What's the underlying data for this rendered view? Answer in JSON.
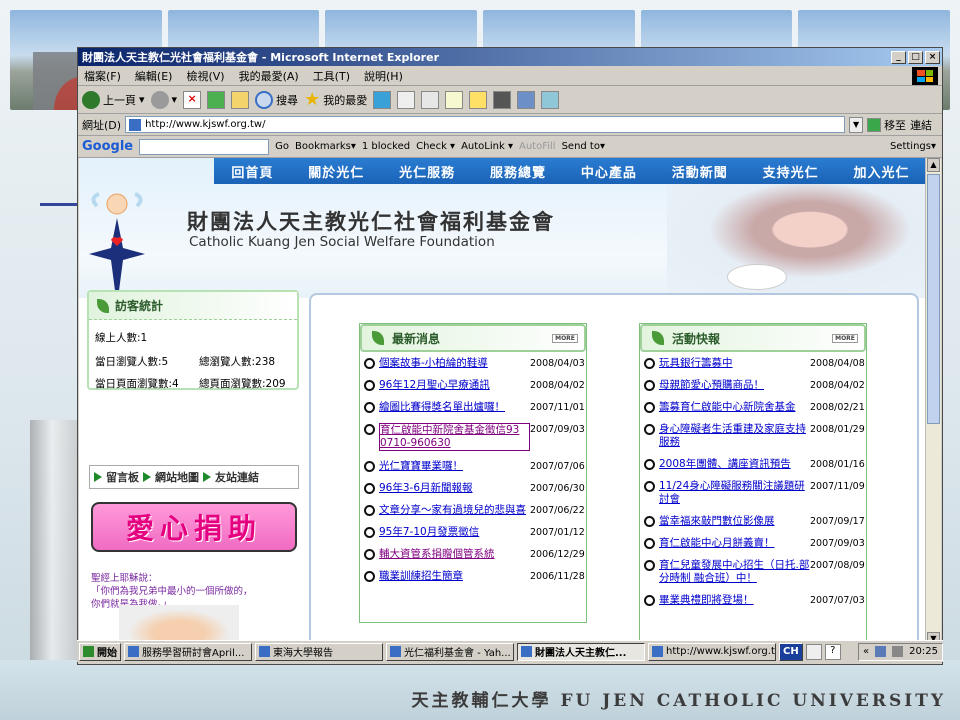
{
  "slide": {
    "university": "天主教輔仁大學 FU JEN CATHOLIC UNIVERSITY"
  },
  "window": {
    "title": "財團法人天主教仁光社會福利基金會 - Microsoft Internet Explorer",
    "controls": [
      "_",
      "□",
      "×"
    ]
  },
  "menu": [
    "檔案(F)",
    "編輯(E)",
    "檢視(V)",
    "我的最愛(A)",
    "工具(T)",
    "說明(H)"
  ],
  "toolbar": {
    "back": "上一頁",
    "search": "搜尋",
    "favorites": "我的最愛"
  },
  "address": {
    "label": "網址(D)",
    "url": "http://www.kjswf.org.tw/",
    "go": "移至",
    "links": "連結"
  },
  "google": {
    "logo": "Google",
    "go": "Go",
    "bookmarks": "Bookmarks▾",
    "blocked": "1 blocked",
    "check": "Check ▾",
    "autolink": "AutoLink ▾",
    "autofill": "AutoFill",
    "sendto": "Send to▾",
    "settings": "Settings▾"
  },
  "site": {
    "nav": [
      "回首頁",
      "關於光仁",
      "光仁服務",
      "服務總覽",
      "中心產品",
      "活動新聞",
      "支持光仁",
      "加入光仁"
    ],
    "org_name": "財團法人天主教光仁社會福利基金會",
    "org_english": "Catholic Kuang Jen Social Welfare Foundation",
    "stats": {
      "title": "訪客統計",
      "online": "線上人數:1",
      "today": "當日瀏覽人數:5",
      "total": "總瀏覽人數:238",
      "today_pages": "當日頁面瀏覽數:4",
      "total_pages": "總頁面瀏覽數:209"
    },
    "links": [
      "留言板",
      "網站地圖",
      "友站連結"
    ],
    "donate": "愛心捐助",
    "quote_line1": "聖經上耶穌說：",
    "quote_line2": "「你們為我兄弟中最小的一個所做的，",
    "quote_line3": "你們就是為我做。」",
    "more": "MORE",
    "news": {
      "title": "最新消息",
      "items": [
        {
          "text": "個案故事-小柏綸的鞋導",
          "date": "2008/04/03"
        },
        {
          "text": "96年12月聖心早療通訊",
          "date": "2008/04/02"
        },
        {
          "text": "繪圖比賽得獎名單出爐囉！",
          "date": "2007/11/01"
        },
        {
          "text": "育仁啟能中新院舍基金徵信93 0710-960630",
          "date": "2007/09/03"
        },
        {
          "text": "光仁寶寶畢業囉！",
          "date": "2007/07/06"
        },
        {
          "text": "96年3-6月新聞報報",
          "date": "2007/06/30"
        },
        {
          "text": "文章分享～家有過境兒的悲與喜",
          "date": "2007/06/22"
        },
        {
          "text": "95年7-10月發票徵信",
          "date": "2007/01/12"
        },
        {
          "text": "輔大資管系捐贈個管系統",
          "date": "2006/12/29"
        },
        {
          "text": "職業訓練招生簡章",
          "date": "2006/11/28"
        }
      ]
    },
    "events": {
      "title": "活動快報",
      "items": [
        {
          "text": "玩具銀行籌募中",
          "date": "2008/04/08"
        },
        {
          "text": "母親節愛心預購商品！",
          "date": "2008/04/02"
        },
        {
          "text": "籌募育仁啟能中心新院舍基金",
          "date": "2008/02/21"
        },
        {
          "text": "身心障礙者生活重建及家庭支持服務",
          "date": "2008/01/29"
        },
        {
          "text": "2008年團體、講座資訊預告",
          "date": "2008/01/16"
        },
        {
          "text": "11/24身心障礙服務關注議題研討會",
          "date": "2007/11/09"
        },
        {
          "text": "當幸福來敲門數位影像展",
          "date": "2007/09/17"
        },
        {
          "text": "育仁啟能中心月餅義賣！",
          "date": "2007/09/03"
        },
        {
          "text": "育仁兒童發展中心招生（日托.部分時制 融合班）中！",
          "date": "2007/08/09"
        },
        {
          "text": "畢業典禮即將登場！",
          "date": "2007/07/03"
        }
      ]
    }
  },
  "taskbar": {
    "start": "開始",
    "items": [
      "服務學習研討會April...",
      "東海大學報告",
      "光仁福利基金會 - Yah...",
      "財團法人天主教仁...",
      "http://www.kjswf.org.tw ..."
    ],
    "lang": "CH",
    "clock": "20:25"
  },
  "colors": {
    "nav_blue": "#1a63b6",
    "title_blue": "#0a246a",
    "link": "#0000cc",
    "visited": "#800080",
    "donate_pink": "#f06cc3"
  }
}
